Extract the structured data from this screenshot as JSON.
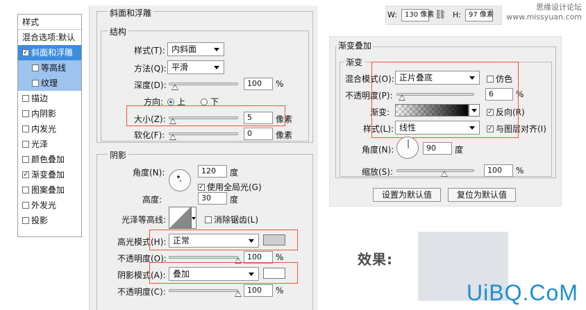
{
  "styles_panel": {
    "header": "样式",
    "items": [
      {
        "label": "混合选项:默认",
        "checkbox": false,
        "state": "none"
      },
      {
        "label": "斜面和浮雕",
        "checkbox": true,
        "checked": true,
        "state": "selected"
      },
      {
        "label": "等高线",
        "checkbox": true,
        "checked": false,
        "state": "sub"
      },
      {
        "label": "纹理",
        "checkbox": true,
        "checked": false,
        "state": "sub"
      },
      {
        "label": "描边",
        "checkbox": true,
        "checked": false,
        "state": "none"
      },
      {
        "label": "内阴影",
        "checkbox": true,
        "checked": false,
        "state": "none"
      },
      {
        "label": "内发光",
        "checkbox": true,
        "checked": false,
        "state": "none"
      },
      {
        "label": "光泽",
        "checkbox": true,
        "checked": false,
        "state": "none"
      },
      {
        "label": "颜色叠加",
        "checkbox": true,
        "checked": false,
        "state": "none"
      },
      {
        "label": "渐变叠加",
        "checkbox": true,
        "checked": true,
        "state": "none"
      },
      {
        "label": "图案叠加",
        "checkbox": true,
        "checked": false,
        "state": "none"
      },
      {
        "label": "外发光",
        "checkbox": true,
        "checked": false,
        "state": "none"
      },
      {
        "label": "投影",
        "checkbox": true,
        "checked": false,
        "state": "none"
      }
    ]
  },
  "bevel": {
    "title": "斜面和浮雕",
    "structure": {
      "title": "结构",
      "style_label": "样式(T):",
      "style_value": "内斜面",
      "technique_label": "方法(Q):",
      "technique_value": "平滑",
      "depth_label": "深度(D):",
      "depth_value": "100",
      "depth_unit": "%",
      "direction_label": "方向:",
      "direction_up": "上",
      "direction_down": "下",
      "size_label": "大小(Z):",
      "size_value": "5",
      "size_unit": "像素",
      "soften_label": "软化(F):",
      "soften_value": "0",
      "soften_unit": "像素"
    },
    "shading": {
      "title": "阴影",
      "angle_label": "角度(N):",
      "angle_value": "120",
      "angle_unit": "度",
      "global_light_label": "使用全局光(G)",
      "altitude_label": "高度:",
      "altitude_value": "30",
      "altitude_unit": "度",
      "gloss_label": "光泽等高线:",
      "anti_alias_label": "消除锯齿(L)",
      "highlight_mode_label": "高光模式(H):",
      "highlight_mode_value": "正常",
      "highlight_opacity_label": "不透明度(O):",
      "highlight_opacity_value": "100",
      "highlight_opacity_unit": "%",
      "shadow_mode_label": "阴影模式(A):",
      "shadow_mode_value": "叠加",
      "shadow_opacity_label": "不透明度(C):",
      "shadow_opacity_value": "100",
      "shadow_opacity_unit": "%"
    }
  },
  "toolbar": {
    "w_label": "W:",
    "w_value": "130 像素",
    "h_label": "H:",
    "h_value": "97 像素"
  },
  "gradient_overlay": {
    "title": "渐变叠加",
    "subtitle": "渐变",
    "blend_label": "混合模式(O):",
    "blend_value": "正片叠底",
    "dither_label": "仿色",
    "opacity_label": "不透明度(P):",
    "opacity_value": "6",
    "opacity_unit": "%",
    "gradient_label": "渐变:",
    "reverse_label": "反向(R)",
    "style_label": "样式(L):",
    "style_value": "线性",
    "align_label": "与图层对齐(I)",
    "angle_label": "角度(N):",
    "angle_value": "90",
    "angle_unit": "度",
    "scale_label": "缩放(S):",
    "scale_value": "100",
    "scale_unit": "%",
    "set_default": "设置为默认值",
    "reset_default": "复位为默认值"
  },
  "result_label": "效果:",
  "watermark_top_1": "思缘设计论坛",
  "watermark_top_2": "www.missyuan.com",
  "watermark": "UiBQ.CoM",
  "colors": {
    "highlight": "#e8582e",
    "selection": "#3b8de0",
    "highlight_swatch": "#cfcfcf",
    "shadow_swatch": "#ffffff",
    "result_swatch": "#dfe2e7",
    "watermark": "#1e8ed0"
  }
}
